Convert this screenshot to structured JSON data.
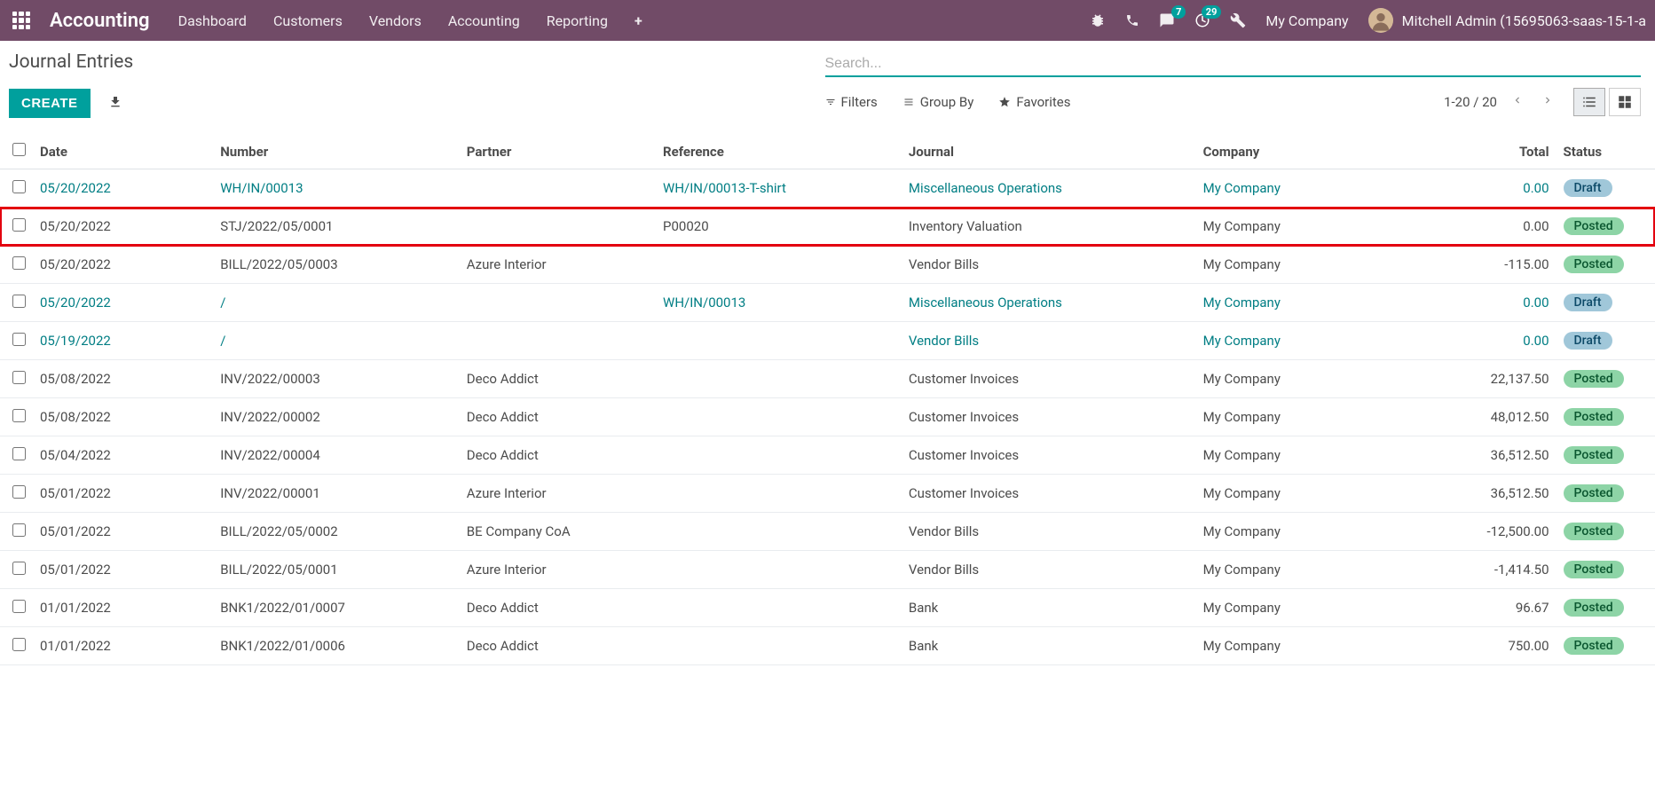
{
  "navbar": {
    "brand": "Accounting",
    "menu": [
      "Dashboard",
      "Customers",
      "Vendors",
      "Accounting",
      "Reporting"
    ],
    "messaging_badge": "7",
    "activity_badge": "29",
    "company": "My Company",
    "user": "Mitchell Admin (15695063-saas-15-1-a"
  },
  "control": {
    "title": "Journal Entries",
    "create": "CREATE",
    "search_placeholder": "Search...",
    "filters": "Filters",
    "groupby": "Group By",
    "favorites": "Favorites",
    "pager": "1-20 / 20"
  },
  "columns": {
    "date": "Date",
    "number": "Number",
    "partner": "Partner",
    "reference": "Reference",
    "journal": "Journal",
    "company": "Company",
    "total": "Total",
    "status": "Status"
  },
  "rows": [
    {
      "date": "05/20/2022",
      "number": "WH/IN/00013",
      "partner": "",
      "reference": "WH/IN/00013-T-shirt",
      "journal": "Miscellaneous Operations",
      "company": "My Company",
      "total": "0.00",
      "status": "Draft",
      "link": true,
      "highlight": false
    },
    {
      "date": "05/20/2022",
      "number": "STJ/2022/05/0001",
      "partner": "",
      "reference": "P00020",
      "journal": "Inventory Valuation",
      "company": "My Company",
      "total": "0.00",
      "status": "Posted",
      "link": false,
      "highlight": true
    },
    {
      "date": "05/20/2022",
      "number": "BILL/2022/05/0003",
      "partner": "Azure Interior",
      "reference": "",
      "journal": "Vendor Bills",
      "company": "My Company",
      "total": "-115.00",
      "status": "Posted",
      "link": false,
      "highlight": false
    },
    {
      "date": "05/20/2022",
      "number": "/",
      "partner": "",
      "reference": "WH/IN/00013",
      "journal": "Miscellaneous Operations",
      "company": "My Company",
      "total": "0.00",
      "status": "Draft",
      "link": true,
      "highlight": false
    },
    {
      "date": "05/19/2022",
      "number": "/",
      "partner": "",
      "reference": "",
      "journal": "Vendor Bills",
      "company": "My Company",
      "total": "0.00",
      "status": "Draft",
      "link": true,
      "highlight": false
    },
    {
      "date": "05/08/2022",
      "number": "INV/2022/00003",
      "partner": "Deco Addict",
      "reference": "",
      "journal": "Customer Invoices",
      "company": "My Company",
      "total": "22,137.50",
      "status": "Posted",
      "link": false,
      "highlight": false
    },
    {
      "date": "05/08/2022",
      "number": "INV/2022/00002",
      "partner": "Deco Addict",
      "reference": "",
      "journal": "Customer Invoices",
      "company": "My Company",
      "total": "48,012.50",
      "status": "Posted",
      "link": false,
      "highlight": false
    },
    {
      "date": "05/04/2022",
      "number": "INV/2022/00004",
      "partner": "Deco Addict",
      "reference": "",
      "journal": "Customer Invoices",
      "company": "My Company",
      "total": "36,512.50",
      "status": "Posted",
      "link": false,
      "highlight": false
    },
    {
      "date": "05/01/2022",
      "number": "INV/2022/00001",
      "partner": "Azure Interior",
      "reference": "",
      "journal": "Customer Invoices",
      "company": "My Company",
      "total": "36,512.50",
      "status": "Posted",
      "link": false,
      "highlight": false
    },
    {
      "date": "05/01/2022",
      "number": "BILL/2022/05/0002",
      "partner": "BE Company CoA",
      "reference": "",
      "journal": "Vendor Bills",
      "company": "My Company",
      "total": "-12,500.00",
      "status": "Posted",
      "link": false,
      "highlight": false
    },
    {
      "date": "05/01/2022",
      "number": "BILL/2022/05/0001",
      "partner": "Azure Interior",
      "reference": "",
      "journal": "Vendor Bills",
      "company": "My Company",
      "total": "-1,414.50",
      "status": "Posted",
      "link": false,
      "highlight": false
    },
    {
      "date": "01/01/2022",
      "number": "BNK1/2022/01/0007",
      "partner": "Deco Addict",
      "reference": "",
      "journal": "Bank",
      "company": "My Company",
      "total": "96.67",
      "status": "Posted",
      "link": false,
      "highlight": false
    },
    {
      "date": "01/01/2022",
      "number": "BNK1/2022/01/0006",
      "partner": "Deco Addict",
      "reference": "",
      "journal": "Bank",
      "company": "My Company",
      "total": "750.00",
      "status": "Posted",
      "link": false,
      "highlight": false
    }
  ]
}
